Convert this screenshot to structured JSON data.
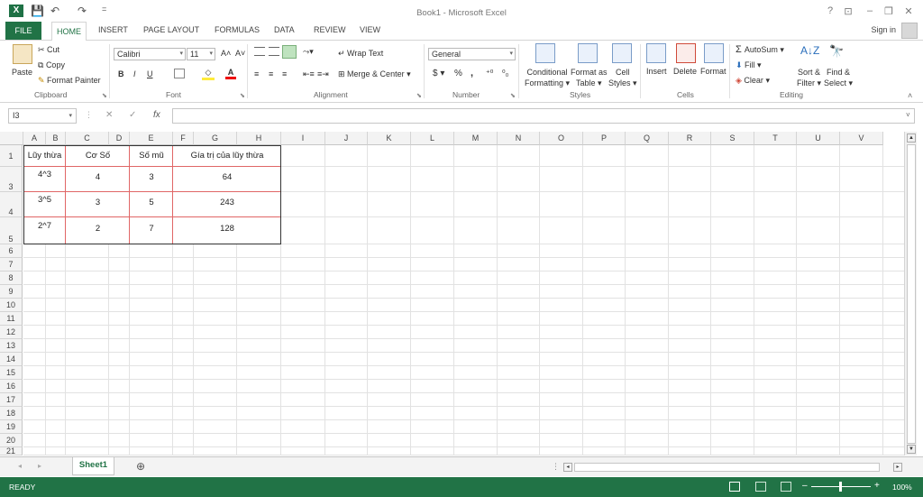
{
  "app": {
    "title": "Book1 - Microsoft Excel",
    "logo": "X",
    "sign_in": "Sign in",
    "help": "?",
    "ribbon_opts": "⊡",
    "minimize": "–",
    "restore": "❐",
    "close": "✕"
  },
  "quick_access": {
    "save": "💾",
    "undo": "↶",
    "redo": "↷",
    "customize": "="
  },
  "tabs": [
    "FILE",
    "HOME",
    "INSERT",
    "PAGE LAYOUT",
    "FORMULAS",
    "DATA",
    "REVIEW",
    "VIEW"
  ],
  "ribbon": {
    "clipboard": {
      "label": "Clipboard",
      "paste": "Paste",
      "cut": "Cut",
      "copy": "Copy",
      "format_painter": "Format Painter"
    },
    "font": {
      "label": "Font",
      "family": "Calibri",
      "size": "11",
      "bold": "B",
      "italic": "I",
      "underline": "U",
      "grow": "A˄",
      "shrink": "A˅"
    },
    "alignment": {
      "label": "Alignment",
      "wrap_text": "Wrap Text",
      "merge_center": "Merge & Center"
    },
    "number": {
      "label": "Number",
      "format": "General",
      "currency": "$",
      "percent": "%",
      "comma": ",",
      "inc_dec": "⁺⁰",
      "dec_dec": "⁰₀"
    },
    "styles": {
      "label": "Styles",
      "conditional_1": "Conditional",
      "conditional_2": "Formatting",
      "format_table_1": "Format as",
      "format_table_2": "Table",
      "cell_styles_1": "Cell",
      "cell_styles_2": "Styles"
    },
    "cells": {
      "label": "Cells",
      "insert": "Insert",
      "delete": "Delete",
      "format": "Format"
    },
    "editing": {
      "label": "Editing",
      "autosum": "AutoSum",
      "fill": "Fill",
      "clear": "Clear",
      "sort_1": "Sort &",
      "sort_2": "Filter",
      "find_1": "Find &",
      "find_2": "Select"
    }
  },
  "formula_bar": {
    "name_box": "I3",
    "cancel": "✕",
    "enter": "✓",
    "fx": "fx",
    "value": ""
  },
  "columns": [
    "A",
    "B",
    "C",
    "D",
    "E",
    "F",
    "G",
    "H",
    "I",
    "J",
    "K",
    "L",
    "M",
    "N",
    "O",
    "P",
    "Q",
    "R",
    "S",
    "T",
    "U",
    "V"
  ],
  "rows": [
    "1",
    "3",
    "4",
    "5",
    "6",
    "7",
    "8",
    "9",
    "10",
    "11",
    "12",
    "13",
    "14",
    "15",
    "16",
    "17",
    "18",
    "19",
    "20",
    "21"
  ],
  "table": {
    "headers": [
      "Lũy thừa",
      "Cơ Số",
      "Số mũ",
      "Gía trị của lũy thừa"
    ],
    "rows": [
      [
        "4^3",
        "4",
        "3",
        "64"
      ],
      [
        "3^5",
        "3",
        "5",
        "243"
      ],
      [
        "2^7",
        "2",
        "7",
        "128"
      ]
    ]
  },
  "sheets": {
    "active": "Sheet1",
    "add": "⊕"
  },
  "status": {
    "ready": "READY",
    "zoom": "100%"
  }
}
